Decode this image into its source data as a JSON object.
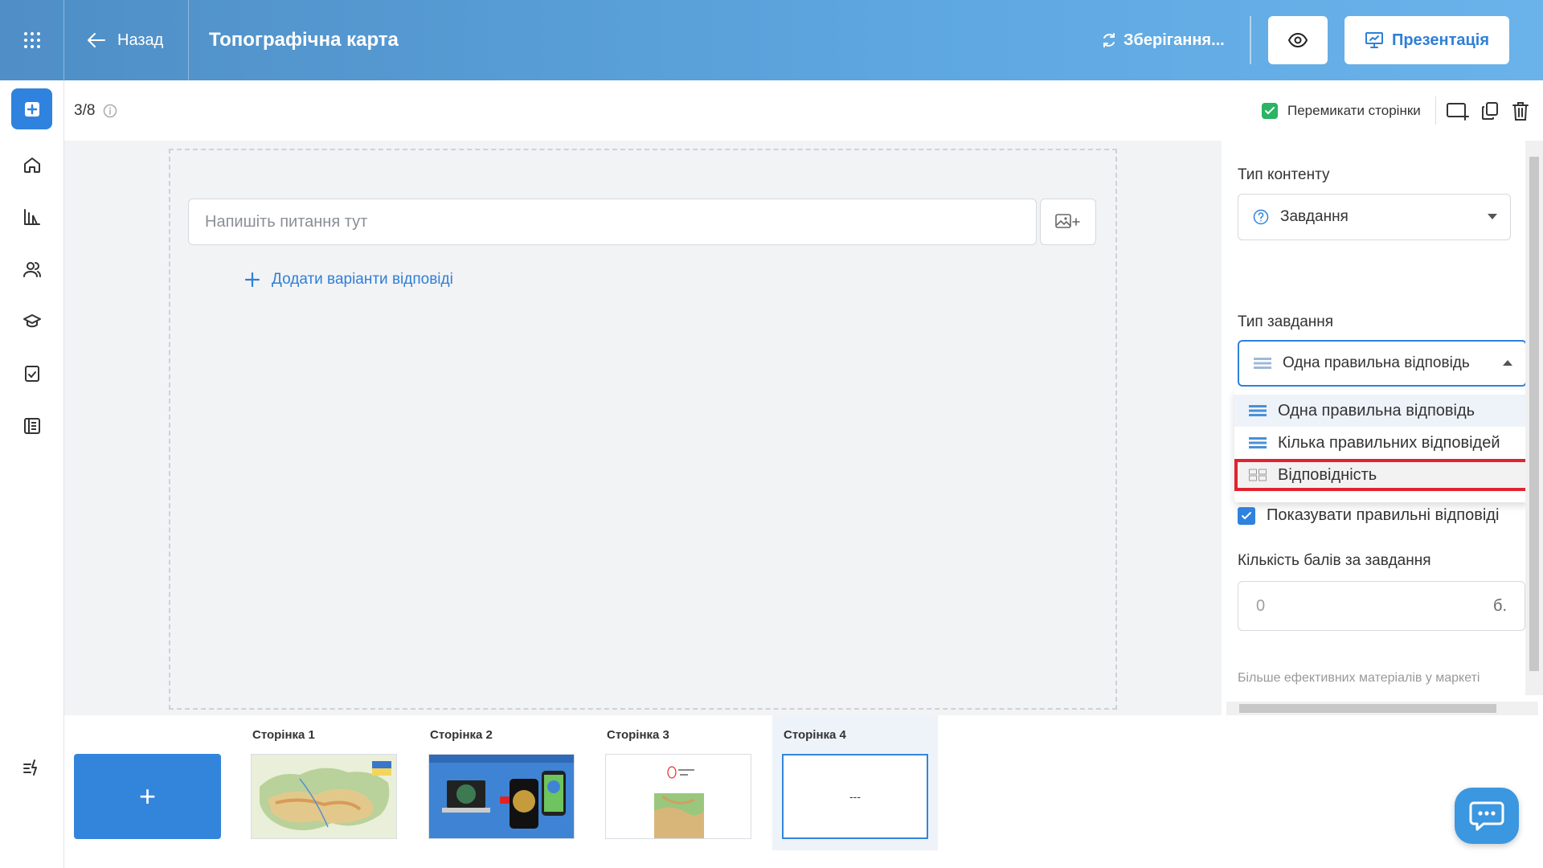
{
  "header": {
    "back_label": "Назад",
    "title": "Топографічна карта",
    "saving_label": "Зберігання...",
    "present_label": "Презентація"
  },
  "toolbar": {
    "page_counter": "3/8",
    "switch_pages_label": "Перемикати сторінки",
    "switch_pages_checked": true
  },
  "editor": {
    "question_placeholder": "Напишіть питання тут",
    "add_answers_label": "Додати варіанти відповіді"
  },
  "panel": {
    "content_type_label": "Тип контенту",
    "content_type_value": "Завдання",
    "task_type_label": "Тип завдання",
    "task_type_value": "Одна правильна відповідь",
    "task_type_options": [
      {
        "label": "Одна правильна відповідь",
        "selected": true
      },
      {
        "label": "Кілька правильних відповідей",
        "selected": false
      },
      {
        "label": "Відповідність",
        "highlighted": true
      }
    ],
    "show_correct_label": "Показувати правильні відповіді",
    "show_correct_checked": true,
    "points_label": "Кількість балів за завдання",
    "points_placeholder": "0",
    "points_unit": "б.",
    "more_materials": "Більше ефективних матеріалів у маркеті"
  },
  "pages": [
    {
      "label": "Сторінка 1",
      "thumb": "map-of-ukraine"
    },
    {
      "label": "Сторінка 2",
      "thumb": "devices-illustration"
    },
    {
      "label": "Сторінка 3",
      "thumb": "relief-map"
    },
    {
      "label": "Сторінка 4",
      "thumb": "empty",
      "thumb_text": "---",
      "active": true
    }
  ],
  "add_page_label": "+",
  "colors": {
    "accent": "#2f82dd",
    "highlight_border": "#e0232f",
    "check_green": "#2ab463"
  }
}
